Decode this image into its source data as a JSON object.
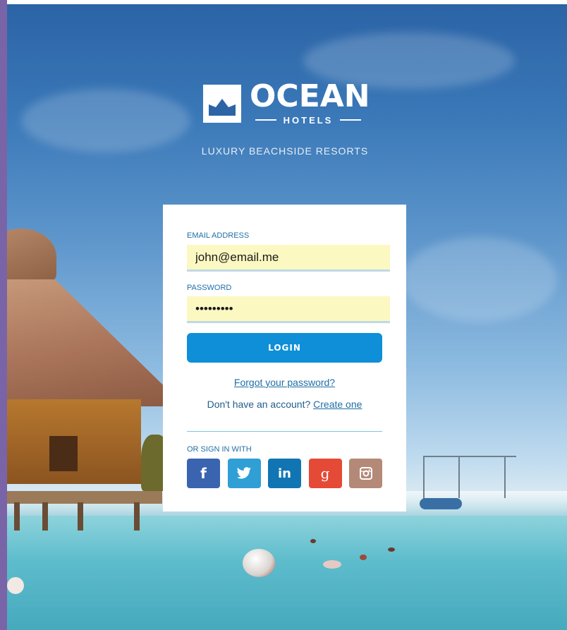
{
  "brand": {
    "name": "OCEAN",
    "sub": "HOTELS",
    "tagline": "LUXURY BEACHSIDE RESORTS"
  },
  "form": {
    "email_label": "EMAIL ADDRESS",
    "email_value": "john@email.me",
    "password_label": "PASSWORD",
    "password_value": "password1",
    "login_label": "LOGIN",
    "forgot_link": "Forgot your password?",
    "no_account_text": "Don't have an account?",
    "create_link": "Create one"
  },
  "social": {
    "label": "OR SIGN IN WITH",
    "buttons": [
      {
        "name": "facebook",
        "glyph": "f",
        "icon": "facebook-icon",
        "color": "#3a64b0"
      },
      {
        "name": "twitter",
        "glyph": "",
        "icon": "twitter-icon",
        "color": "#2f9fd5"
      },
      {
        "name": "linkedin",
        "glyph": "in",
        "icon": "linkedin-icon",
        "color": "#1075b2"
      },
      {
        "name": "google",
        "glyph": "g",
        "icon": "google-plus-icon",
        "color": "#e44a36"
      },
      {
        "name": "instagram",
        "glyph": "",
        "icon": "instagram-icon",
        "color": "#b48977"
      }
    ]
  },
  "colors": {
    "accent": "#0e8fd8",
    "label": "#1f6fa8",
    "input_bg": "#fbf8c2"
  }
}
